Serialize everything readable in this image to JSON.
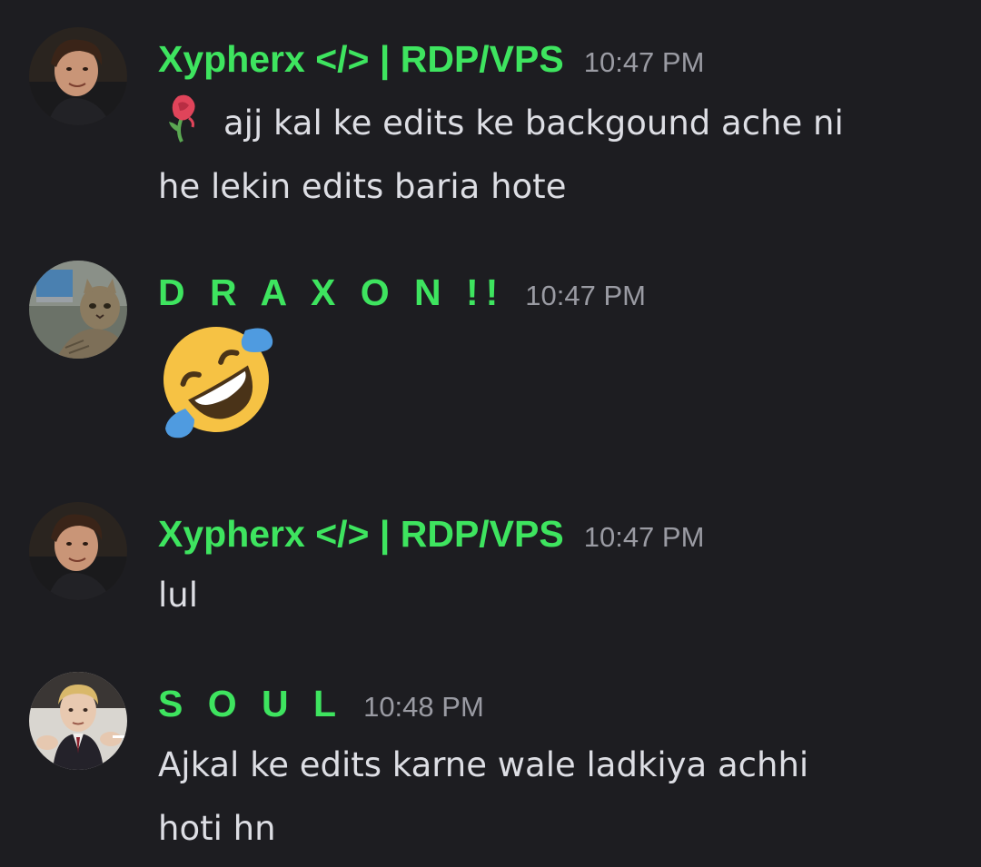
{
  "messages": [
    {
      "author": "Xypherx </> | RDP/VPS",
      "timestamp": "10:47 PM",
      "lines": [
        "ajj kal ke edits ke backgound ache ni",
        "he lekin edits baria hote"
      ],
      "leading_emoji": "wilted-rose-emoji",
      "avatar": "avatar-man-dark-hair"
    },
    {
      "author": "D R A X O N !!",
      "timestamp": "10:47 PM",
      "lines": [],
      "emoji": "rolling-on-floor-laughing-emoji",
      "avatar": "avatar-cat-with-laptop"
    },
    {
      "author": "Xypherx </> | RDP/VPS",
      "timestamp": "10:47 PM",
      "lines": [
        "lul"
      ],
      "avatar": "avatar-man-dark-hair"
    },
    {
      "author": "S O U L",
      "timestamp": "10:48 PM",
      "lines": [
        "Ajkal ke edits karne wale ladkiya achhi",
        "hoti hn"
      ],
      "avatar": "avatar-boy-in-suit"
    }
  ],
  "colors": {
    "background": "#1d1d21",
    "username": "#3ee45f",
    "timestamp": "#9a9ba3",
    "text": "#dddee4"
  }
}
